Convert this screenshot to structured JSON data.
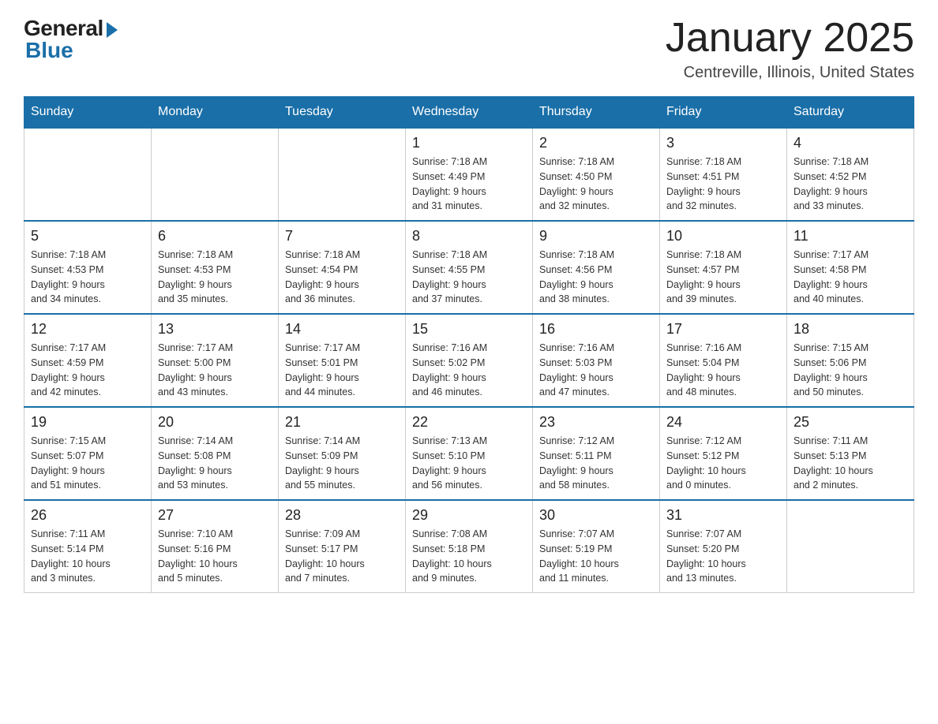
{
  "logo": {
    "general": "General",
    "blue": "Blue"
  },
  "header": {
    "title": "January 2025",
    "subtitle": "Centreville, Illinois, United States"
  },
  "days_of_week": [
    "Sunday",
    "Monday",
    "Tuesday",
    "Wednesday",
    "Thursday",
    "Friday",
    "Saturday"
  ],
  "weeks": [
    [
      {
        "day": "",
        "info": ""
      },
      {
        "day": "",
        "info": ""
      },
      {
        "day": "",
        "info": ""
      },
      {
        "day": "1",
        "info": "Sunrise: 7:18 AM\nSunset: 4:49 PM\nDaylight: 9 hours\nand 31 minutes."
      },
      {
        "day": "2",
        "info": "Sunrise: 7:18 AM\nSunset: 4:50 PM\nDaylight: 9 hours\nand 32 minutes."
      },
      {
        "day": "3",
        "info": "Sunrise: 7:18 AM\nSunset: 4:51 PM\nDaylight: 9 hours\nand 32 minutes."
      },
      {
        "day": "4",
        "info": "Sunrise: 7:18 AM\nSunset: 4:52 PM\nDaylight: 9 hours\nand 33 minutes."
      }
    ],
    [
      {
        "day": "5",
        "info": "Sunrise: 7:18 AM\nSunset: 4:53 PM\nDaylight: 9 hours\nand 34 minutes."
      },
      {
        "day": "6",
        "info": "Sunrise: 7:18 AM\nSunset: 4:53 PM\nDaylight: 9 hours\nand 35 minutes."
      },
      {
        "day": "7",
        "info": "Sunrise: 7:18 AM\nSunset: 4:54 PM\nDaylight: 9 hours\nand 36 minutes."
      },
      {
        "day": "8",
        "info": "Sunrise: 7:18 AM\nSunset: 4:55 PM\nDaylight: 9 hours\nand 37 minutes."
      },
      {
        "day": "9",
        "info": "Sunrise: 7:18 AM\nSunset: 4:56 PM\nDaylight: 9 hours\nand 38 minutes."
      },
      {
        "day": "10",
        "info": "Sunrise: 7:18 AM\nSunset: 4:57 PM\nDaylight: 9 hours\nand 39 minutes."
      },
      {
        "day": "11",
        "info": "Sunrise: 7:17 AM\nSunset: 4:58 PM\nDaylight: 9 hours\nand 40 minutes."
      }
    ],
    [
      {
        "day": "12",
        "info": "Sunrise: 7:17 AM\nSunset: 4:59 PM\nDaylight: 9 hours\nand 42 minutes."
      },
      {
        "day": "13",
        "info": "Sunrise: 7:17 AM\nSunset: 5:00 PM\nDaylight: 9 hours\nand 43 minutes."
      },
      {
        "day": "14",
        "info": "Sunrise: 7:17 AM\nSunset: 5:01 PM\nDaylight: 9 hours\nand 44 minutes."
      },
      {
        "day": "15",
        "info": "Sunrise: 7:16 AM\nSunset: 5:02 PM\nDaylight: 9 hours\nand 46 minutes."
      },
      {
        "day": "16",
        "info": "Sunrise: 7:16 AM\nSunset: 5:03 PM\nDaylight: 9 hours\nand 47 minutes."
      },
      {
        "day": "17",
        "info": "Sunrise: 7:16 AM\nSunset: 5:04 PM\nDaylight: 9 hours\nand 48 minutes."
      },
      {
        "day": "18",
        "info": "Sunrise: 7:15 AM\nSunset: 5:06 PM\nDaylight: 9 hours\nand 50 minutes."
      }
    ],
    [
      {
        "day": "19",
        "info": "Sunrise: 7:15 AM\nSunset: 5:07 PM\nDaylight: 9 hours\nand 51 minutes."
      },
      {
        "day": "20",
        "info": "Sunrise: 7:14 AM\nSunset: 5:08 PM\nDaylight: 9 hours\nand 53 minutes."
      },
      {
        "day": "21",
        "info": "Sunrise: 7:14 AM\nSunset: 5:09 PM\nDaylight: 9 hours\nand 55 minutes."
      },
      {
        "day": "22",
        "info": "Sunrise: 7:13 AM\nSunset: 5:10 PM\nDaylight: 9 hours\nand 56 minutes."
      },
      {
        "day": "23",
        "info": "Sunrise: 7:12 AM\nSunset: 5:11 PM\nDaylight: 9 hours\nand 58 minutes."
      },
      {
        "day": "24",
        "info": "Sunrise: 7:12 AM\nSunset: 5:12 PM\nDaylight: 10 hours\nand 0 minutes."
      },
      {
        "day": "25",
        "info": "Sunrise: 7:11 AM\nSunset: 5:13 PM\nDaylight: 10 hours\nand 2 minutes."
      }
    ],
    [
      {
        "day": "26",
        "info": "Sunrise: 7:11 AM\nSunset: 5:14 PM\nDaylight: 10 hours\nand 3 minutes."
      },
      {
        "day": "27",
        "info": "Sunrise: 7:10 AM\nSunset: 5:16 PM\nDaylight: 10 hours\nand 5 minutes."
      },
      {
        "day": "28",
        "info": "Sunrise: 7:09 AM\nSunset: 5:17 PM\nDaylight: 10 hours\nand 7 minutes."
      },
      {
        "day": "29",
        "info": "Sunrise: 7:08 AM\nSunset: 5:18 PM\nDaylight: 10 hours\nand 9 minutes."
      },
      {
        "day": "30",
        "info": "Sunrise: 7:07 AM\nSunset: 5:19 PM\nDaylight: 10 hours\nand 11 minutes."
      },
      {
        "day": "31",
        "info": "Sunrise: 7:07 AM\nSunset: 5:20 PM\nDaylight: 10 hours\nand 13 minutes."
      },
      {
        "day": "",
        "info": ""
      }
    ]
  ]
}
